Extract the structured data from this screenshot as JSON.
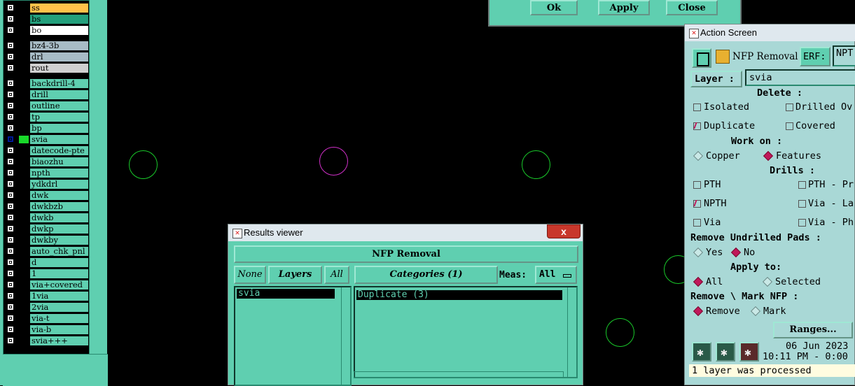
{
  "layers": [
    {
      "name": "ss",
      "bg": "#ffc24a"
    },
    {
      "name": "bs",
      "bg": "#23a07c"
    },
    {
      "name": "bo",
      "bg": "#ffffff"
    },
    {
      "name": "bz4-3b",
      "bg": "#a8bcc6"
    },
    {
      "name": "drl",
      "bg": "#a8bcc6"
    },
    {
      "name": "rout",
      "bg": "#d0d0d0"
    },
    {
      "name": "backdrill-4",
      "bg": "#5fcfb0"
    },
    {
      "name": "drill",
      "bg": "#5fcfb0"
    },
    {
      "name": "outline",
      "bg": "#5fcfb0"
    },
    {
      "name": "tp",
      "bg": "#5fcfb0"
    },
    {
      "name": "bp",
      "bg": "#5fcfb0"
    },
    {
      "name": "svia",
      "bg": "#5fcfb0",
      "active": true
    },
    {
      "name": "datecode-pte",
      "bg": "#5fcfb0"
    },
    {
      "name": "biaozhu",
      "bg": "#5fcfb0"
    },
    {
      "name": "npth",
      "bg": "#5fcfb0"
    },
    {
      "name": "ydkdrl",
      "bg": "#5fcfb0"
    },
    {
      "name": "dwk",
      "bg": "#5fcfb0"
    },
    {
      "name": "dwkbzb",
      "bg": "#5fcfb0"
    },
    {
      "name": "dwkb",
      "bg": "#5fcfb0"
    },
    {
      "name": "dwkp",
      "bg": "#5fcfb0"
    },
    {
      "name": "dwkby",
      "bg": "#5fcfb0"
    },
    {
      "name": "auto_chk_pnl",
      "bg": "#5fcfb0"
    },
    {
      "name": "d",
      "bg": "#5fcfb0"
    },
    {
      "name": "1",
      "bg": "#5fcfb0"
    },
    {
      "name": "via+covered",
      "bg": "#5fcfb0"
    },
    {
      "name": "1via",
      "bg": "#5fcfb0"
    },
    {
      "name": "2via",
      "bg": "#5fcfb0"
    },
    {
      "name": "via-t",
      "bg": "#5fcfb0"
    },
    {
      "name": "via-b",
      "bg": "#5fcfb0"
    },
    {
      "name": "svia+++",
      "bg": "#5fcfb0"
    }
  ],
  "top_dialog": {
    "ok": "Ok",
    "apply": "Apply",
    "close": "Close"
  },
  "results": {
    "title": "Results viewer",
    "close_glyph": "x",
    "header": "NFP Removal",
    "none_btn": "None",
    "layers_btn": "Layers",
    "all_btn": "All",
    "categories_btn": "Categories (1)",
    "meas_label": "Meas:",
    "meas_value": "All",
    "layer_items": [
      "svia"
    ],
    "category_items": [
      "Duplicate (3)"
    ]
  },
  "action": {
    "title": "Action Screen",
    "action_name": "NFP Removal",
    "erf_label": "ERF:",
    "erf_value": "NPT",
    "layer_label": "Layer :",
    "layer_value": "svia",
    "delete_hdr": "Delete :",
    "isolated": "Isolated",
    "drilled_over": "Drilled Ov",
    "duplicate": "Duplicate",
    "covered": "Covered",
    "work_on_hdr": "Work on :",
    "copper": "Copper",
    "features": "Features",
    "drills_hdr": "Drills :",
    "pth": "PTH",
    "pth_press": "PTH - Pr",
    "npth": "NPTH",
    "via_laser": "Via - La",
    "via": "Via",
    "via_photo": "Via - Ph",
    "remove_undrilled_hdr": "Remove Undrilled Pads :",
    "yes": "Yes",
    "no": "No",
    "apply_to_hdr": "Apply to:",
    "all": "All",
    "selected": "Selected",
    "remove_mark_hdr": "Remove \\ Mark  NFP :",
    "remove": "Remove",
    "mark": "Mark",
    "ranges_btn": "Ranges...",
    "date": "06 Jun 2023",
    "time": "10:11 PM - 0:00",
    "status": "1 layer was processed"
  }
}
